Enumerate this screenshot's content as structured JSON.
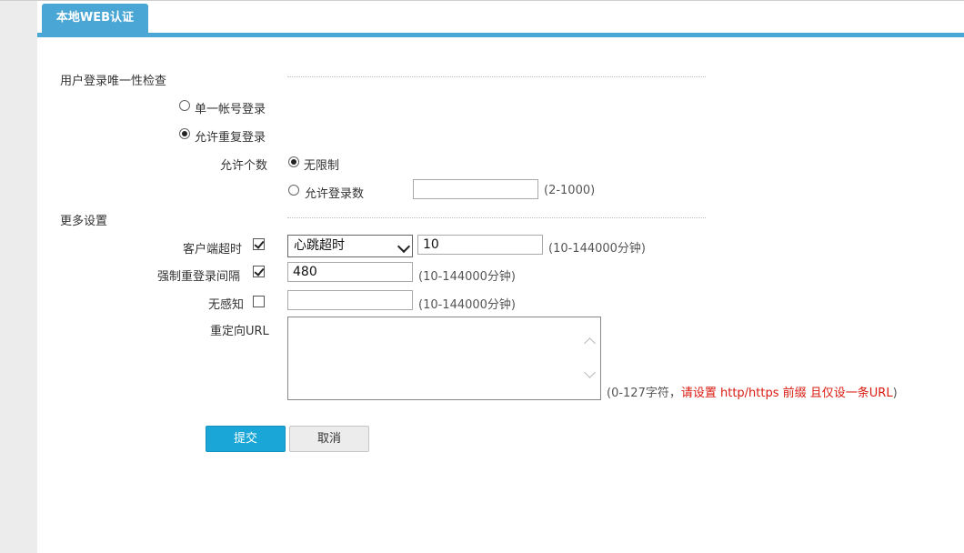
{
  "tab": {
    "title": "本地WEB认证"
  },
  "section_login": {
    "title": "用户登录唯一性检查",
    "single_label": "单一帐号登录",
    "allow_repeat_label": "允许重复登录",
    "allow_count_label": "允许个数",
    "unlimited_label": "无限制",
    "allow_login_count_label": "允许登录数",
    "allow_login_count_value": "",
    "allow_login_count_hint": "(2-1000)"
  },
  "section_more": {
    "title": "更多设置",
    "client_timeout_label": "客户端超时",
    "client_timeout_checked": true,
    "client_timeout_mode": "心跳超时",
    "client_timeout_value": "10",
    "client_timeout_hint": "(10-144000分钟)",
    "relogin_label": "强制重登录间隔",
    "relogin_checked": true,
    "relogin_value": "480",
    "relogin_hint": "(10-144000分钟)",
    "seamless_label": "无感知",
    "seamless_checked": false,
    "seamless_value": "",
    "seamless_hint": "(10-144000分钟)",
    "redirect_label": "重定向URL",
    "redirect_value": "",
    "redirect_hint_prefix": "(0-127字符，",
    "redirect_hint_warning": "请设置 http/https 前缀 且仅设一条URL",
    "redirect_hint_suffix": ")"
  },
  "buttons": {
    "submit": "提交",
    "cancel": "取消"
  },
  "colors": {
    "accent": "#4aa6d4",
    "submit": "#1aa6d6",
    "warning": "#d9190f"
  }
}
